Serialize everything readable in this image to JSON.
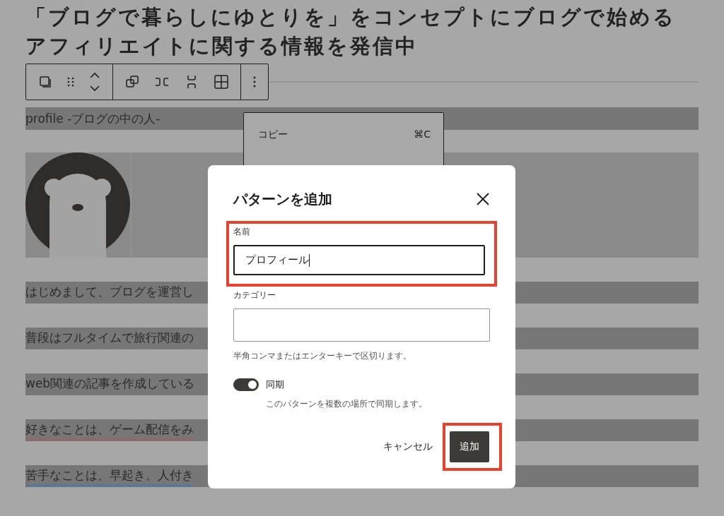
{
  "post_title": "「ブログで暮らしにゆとりを」をコンセプトにブログで始めるアフィリエイトに関する情報を発信中",
  "block_toolbar": {
    "groups": [
      [
        {
          "kind": "copy"
        },
        {
          "kind": "drag"
        },
        {
          "kind": "move"
        }
      ],
      [
        {
          "kind": "group"
        },
        {
          "kind": "row"
        },
        {
          "kind": "stack"
        },
        {
          "kind": "grid"
        }
      ],
      [
        {
          "kind": "more"
        }
      ]
    ]
  },
  "heading_block": "profile -ブログの中の人-",
  "paragraphs": [
    {
      "text": "はじめまして、ブログを運営し"
    },
    {
      "text": "普段はフルタイムで旅行関連の"
    },
    {
      "text": "web関連の記事を作成している"
    },
    {
      "text": "好きなことは、ゲーム配信をみ",
      "color": "#8a6a6a"
    },
    {
      "text": "苦手なことは、早起き、人付き",
      "color": "#5f7690"
    }
  ],
  "context_menu": {
    "items": [
      {
        "label": "コピー",
        "shortcut": "⌘C"
      }
    ]
  },
  "dialog": {
    "title": "パターンを追加",
    "name_field": {
      "label": "名前",
      "value": "プロフィール",
      "highlighted": true
    },
    "category_field": {
      "label": "カテゴリー",
      "help": "半角コンマまたはエンターキーで区切ります。"
    },
    "sync": {
      "label": "同期",
      "description": "このパターンを複数の場所で同期します。",
      "on": true
    },
    "cancel_button": "キャンセル",
    "add_button": {
      "label": "追加",
      "highlighted": true
    }
  }
}
